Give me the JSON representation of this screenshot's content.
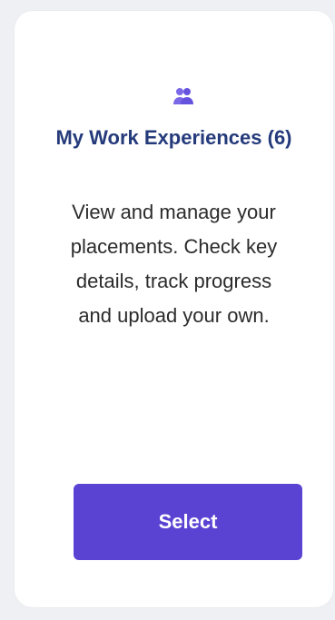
{
  "card": {
    "icon": "people-icon",
    "title": "My Work Experiences (6)",
    "description": "View and manage your placements. Check key details, track progress and upload your own.",
    "button_label": "Select",
    "colors": {
      "accent": "#5a43d3",
      "title": "#243a7a",
      "text": "#2b2b2b",
      "background": "#eef0f3",
      "card": "#ffffff"
    }
  }
}
